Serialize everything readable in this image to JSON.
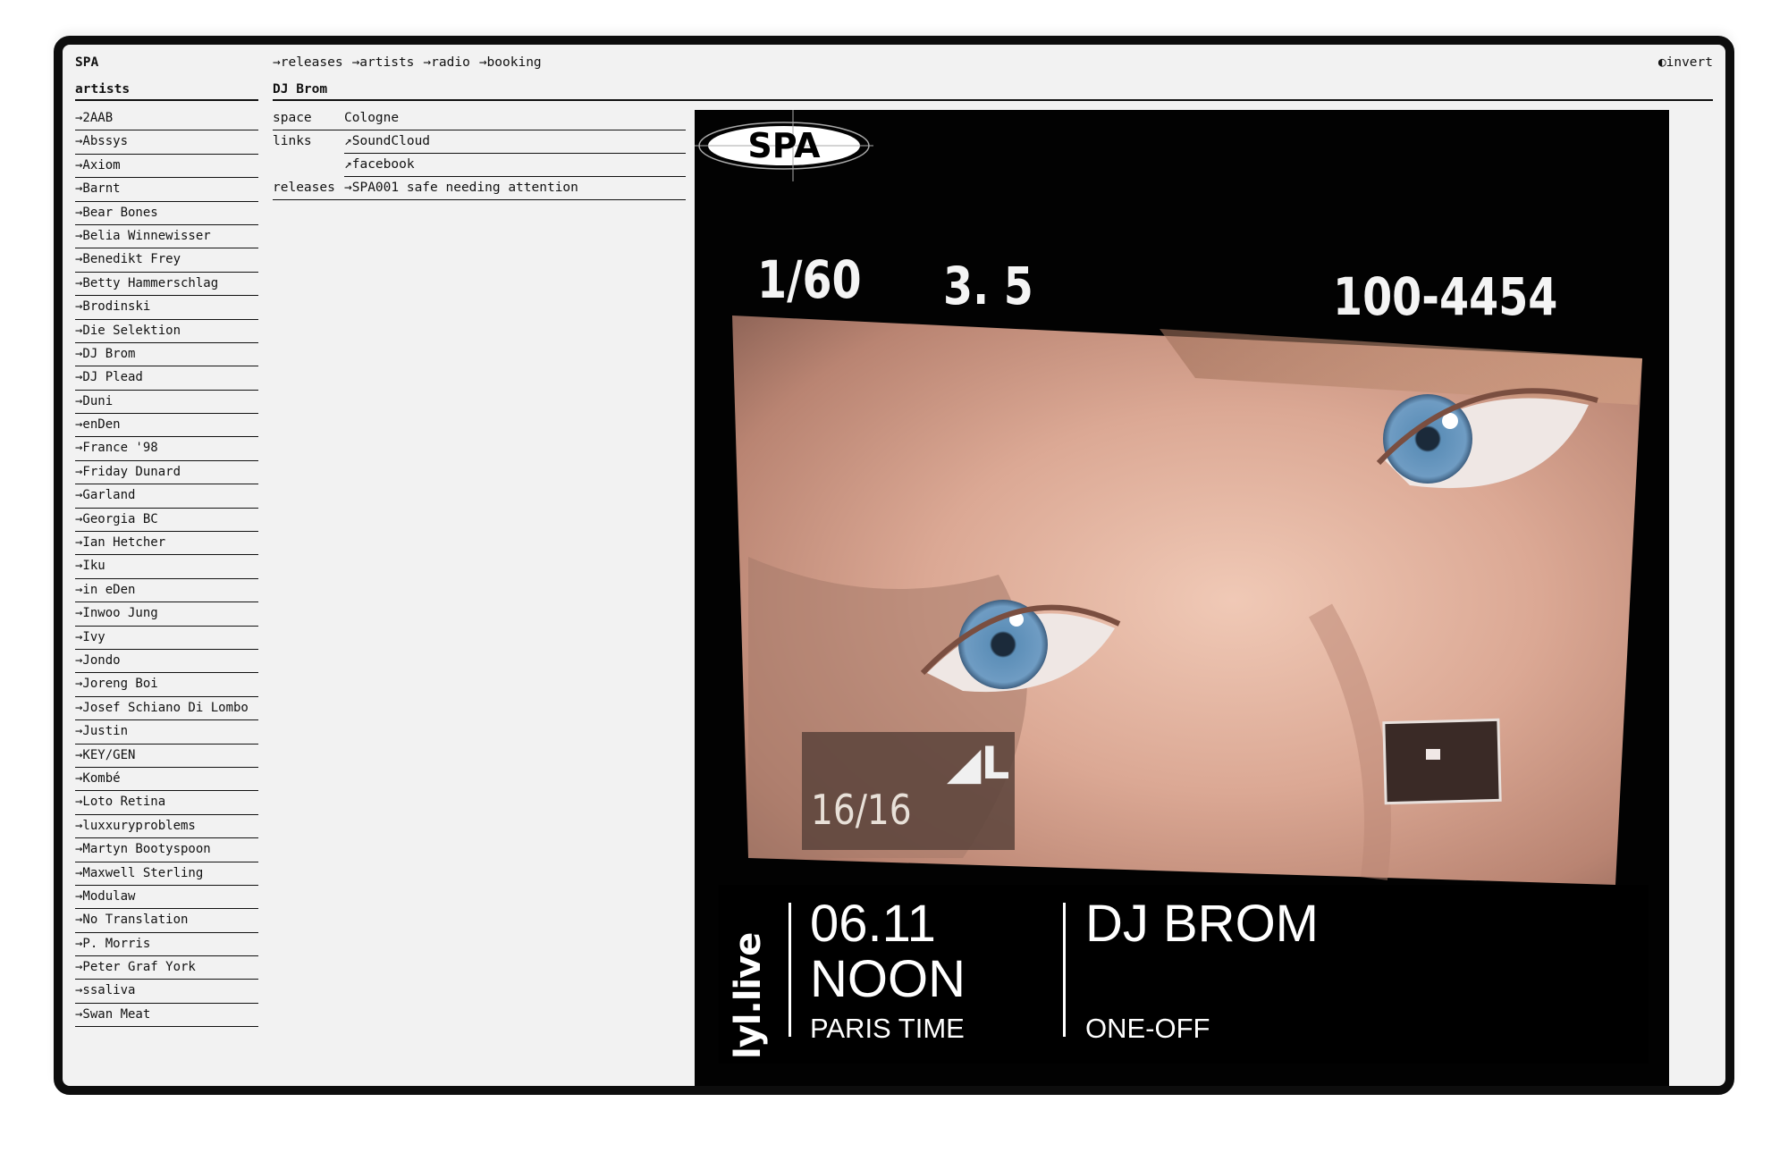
{
  "site": {
    "logo": "SPA",
    "invert_label": "◐invert"
  },
  "nav": [
    {
      "label": "→releases"
    },
    {
      "label": "→artists"
    },
    {
      "label": "→radio"
    },
    {
      "label": "→booking"
    }
  ],
  "sidebar": {
    "title": "artists",
    "items": [
      "→2AAB",
      "→Abssys",
      "→Axiom",
      "→Barnt",
      "→Bear Bones",
      "→Belia Winnewisser",
      "→Benedikt Frey",
      "→Betty Hammerschlag",
      "→Brodinski",
      "→Die Selektion",
      "→DJ Brom",
      "→DJ Plead",
      "→Duni",
      "→enDen",
      "→France '98",
      "→Friday Dunard",
      "→Garland",
      "→Georgia BC",
      "→Ian Hetcher",
      "→Iku",
      "→in eDen",
      "→Inwoo Jung",
      "→Ivy",
      "→Jondo",
      "→Joreng Boi",
      "→Josef Schiano Di Lombo",
      "→Justin",
      "→KEY/GEN",
      "→Kombé",
      "→Loto Retina",
      "→luxxuryproblems",
      "→Martyn Bootyspoon",
      "→Maxwell Sterling",
      "→Modulaw",
      "→No Translation",
      "→P. Morris",
      "→Peter Graf York",
      "→ssaliva",
      "→Swan Meat"
    ]
  },
  "artist": {
    "name": "DJ Brom",
    "space_label": "space",
    "space_value": "Cologne",
    "links_label": "links",
    "links": [
      "↗SoundCloud",
      "↗facebook"
    ],
    "releases_label": "releases",
    "releases": [
      "→SPA001 safe needing attention"
    ]
  },
  "poster": {
    "camera": {
      "shutter": "1/60",
      "aperture": "3. 5",
      "counter": "100-4454",
      "frames": "16/16",
      "quality": "◢L"
    },
    "brand": "lyl.live",
    "date": "06.11",
    "time": "NOON",
    "timezone": "PARIS TIME",
    "artist": "DJ BROM",
    "kind": "ONE-OFF",
    "logo": "SPA"
  }
}
